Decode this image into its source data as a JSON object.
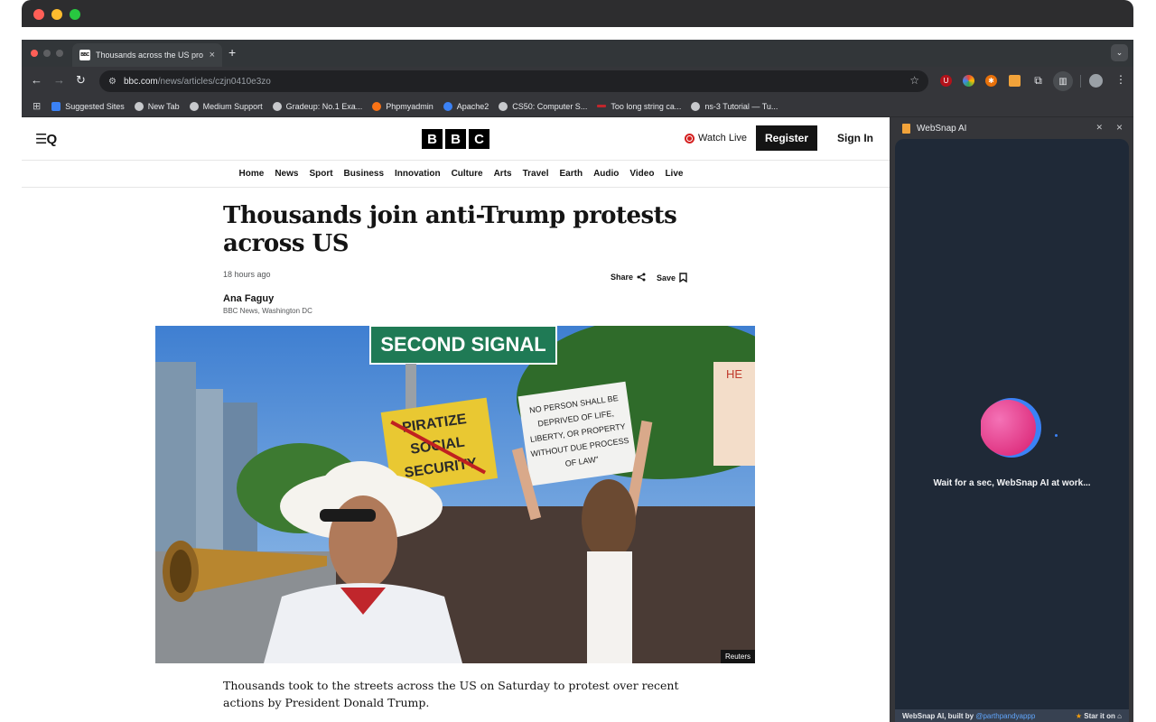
{
  "browser": {
    "tab_title": "Thousands across the US pro",
    "tab_favicon": "BBC",
    "new_tab_glyph": "+",
    "tab_menu_glyph": "⌄",
    "close_glyph": "×",
    "url_host": "bbc.com",
    "url_path": "/news/articles/czjn0410e3zo"
  },
  "bookmarks": [
    {
      "label": "Suggested Sites",
      "icon": "bing-icon"
    },
    {
      "label": "New Tab",
      "icon": "globe-icon"
    },
    {
      "label": "Medium Support",
      "icon": "globe-icon"
    },
    {
      "label": "Gradeup: No.1 Exa...",
      "icon": "globe-icon"
    },
    {
      "label": "Phpmyadmin",
      "icon": "phpmyadmin-icon"
    },
    {
      "label": "Apache2",
      "icon": "apache-icon"
    },
    {
      "label": "CS50: Computer S...",
      "icon": "globe-icon"
    },
    {
      "label": "Too long string ca...",
      "icon": "dash-icon"
    },
    {
      "label": "ns-3 Tutorial — Tu...",
      "icon": "globe-icon"
    }
  ],
  "bbc": {
    "logo_letters": [
      "B",
      "B",
      "C"
    ],
    "menu_glyph": "☰Q",
    "watch_live": "Watch Live",
    "register": "Register",
    "sign_in": "Sign In",
    "nav": [
      "Home",
      "News",
      "Sport",
      "Business",
      "Innovation",
      "Culture",
      "Arts",
      "Travel",
      "Earth",
      "Audio",
      "Video",
      "Live"
    ],
    "headline": "Thousands join anti-Trump protests across US",
    "timestamp": "18 hours ago",
    "share": "Share",
    "save": "Save",
    "author": "Ana Faguy",
    "author_role": "BBC News, Washington DC",
    "photo_credit": "Reuters",
    "lede": "Thousands took to the streets across the US on Saturday to protest over recent actions by President Donald Trump.",
    "photo_signs": {
      "street_sign": "SECOND SIGNAL",
      "sign_yellow": [
        "PIRATIZE",
        "SOCIAL",
        "SECURITY"
      ],
      "sign_white": [
        "NO PERSON SHALL BE",
        "DEPRIVED OF LIFE,",
        "LIBERTY, OR PROPERTY",
        "WITHOUT DUE PROCESS",
        "OF LAW\""
      ],
      "sign_right": "HE"
    }
  },
  "sidepanel": {
    "title": "WebSnap AI",
    "status": "Wait for a sec, WebSnap AI at work...",
    "built_by": "WebSnap AI, built by",
    "handle": "@parthpandyappp",
    "star": "Star it on"
  },
  "colors": {
    "bbc_black": "#141414",
    "live_red": "#d42020",
    "panel_bg": "#1f2937",
    "orb_pink": "#ec4899",
    "orb_blue": "#3b82f6"
  }
}
